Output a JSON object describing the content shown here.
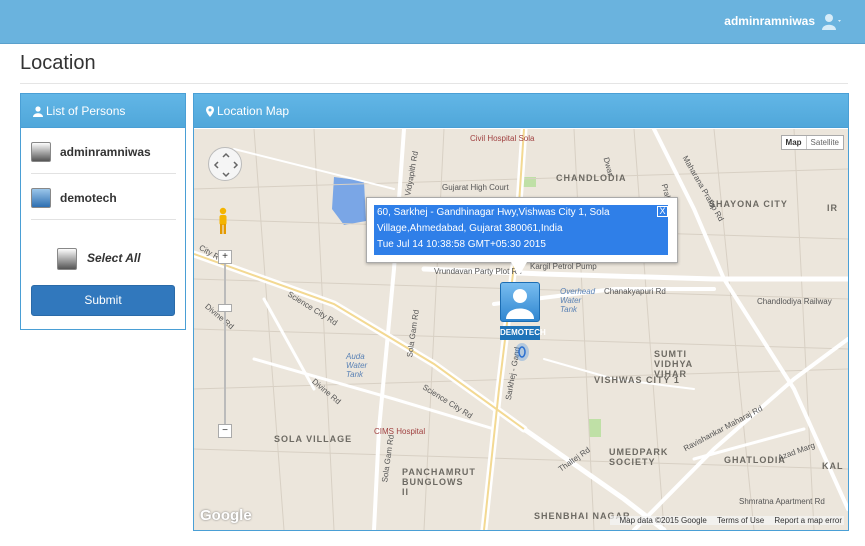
{
  "topbar": {
    "username": "adminramniwas",
    "user_icon": "user-icon",
    "accent": "#6ab3de"
  },
  "page": {
    "title": "Location"
  },
  "persons_panel": {
    "title": "List of Persons",
    "items": [
      {
        "name": "adminramniwas",
        "color": "grey"
      },
      {
        "name": "demotech",
        "color": "blue"
      }
    ],
    "select_all_label": "Select All",
    "submit_label": "Submit"
  },
  "map_panel": {
    "title": "Location Map",
    "map_type": {
      "map": "Map",
      "satellite": "Satellite",
      "selected": "Map"
    },
    "info_window": {
      "line1": "60, Sarkhej - Gandhinagar Hwy,Vishwas City 1, Sola",
      "line2": "Village,Ahmedabad, Gujarat 380061,India",
      "line3": "Tue Jul 14 10:38:58 GMT+05:30 2015",
      "close": "X"
    },
    "marker_label": "DEMOTECH",
    "zoom_in": "+",
    "zoom_out": "−",
    "labels": {
      "civil_hospital": "Civil Hospital Sola",
      "gujarat_high_court": "Gujarat High Court",
      "chandlodia": "CHANDLODIA",
      "shayona_city": "SHAYONA CITY",
      "vrundavan": "Vrundavan Party Plot Rd",
      "kargil": "Kargil Petrol Pump",
      "overhead_tank1": "Overhead Water Tank",
      "overhead_tank2": "Overhead Water Tank",
      "chanakyapuri": "Chanakyapuri Rd",
      "chandlodiya_railway": "Chandlodiya Railway",
      "science_city_rd1": "Science City Rd",
      "science_city_rd2": "Science City Rd",
      "sola_gam_rd1": "Sola Gam Rd",
      "sola_gam_rd2": "Sola Gam Rd",
      "divine_rd": "Divine Rd",
      "auda": "Auda Water Tank",
      "cims": "CIMS Hospital",
      "sola_village": "SOLA VILLAGE",
      "panchamrut": "PANCHAMRUT BUNGLOWS II",
      "sumti": "SUMTI VIDHYA VIHAR",
      "vishwas": "VISHWAS CITY 1",
      "umed": "UMEDPARK SOCIETY",
      "ghatlodia": "GHATLODIA",
      "ravishankar": "Ravishankar Maharaj Rd",
      "azad": "Azad Marg",
      "thaltej": "Thaltej Rd",
      "shmratna": "Shmratna Apartment Rd",
      "shenbhai": "SHENBHAI NAGAR",
      "vidyapith": "Vidyapith Rd",
      "prabhat": "Prabhat Rd",
      "maharana": "Maharana Pratap Rd",
      "city_rd": "City Rd",
      "sarkhej": "Sarkhej - Gand",
      "kal": "KAL",
      "ir": "IR",
      "dwar": "Dwar"
    },
    "footer": {
      "data": "Map data ©2015 Google",
      "terms": "Terms of Use",
      "report": "Report a map error"
    },
    "google_logo": "Google"
  }
}
